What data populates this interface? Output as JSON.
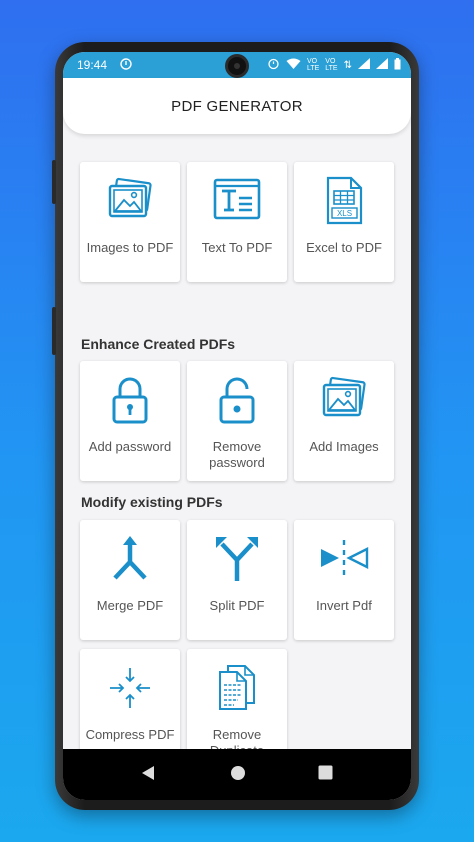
{
  "status": {
    "time": "19:44",
    "battery_icon": "battery-icon",
    "wifi_icon": "wifi-icon",
    "signal_icon": "signal-icon"
  },
  "app": {
    "title": "PDF GENERATOR"
  },
  "colors": {
    "accent": "#1a8fc9",
    "statusbar": "#2aa0d6",
    "background_gradient_top": "#2f6ff0",
    "background_gradient_bottom": "#1ba8ee"
  },
  "sections": {
    "convert": {
      "items": [
        {
          "label": "Images to PDF",
          "icon": "images-icon"
        },
        {
          "label": "Text To PDF",
          "icon": "text-document-icon"
        },
        {
          "label": "Excel to PDF",
          "icon": "xls-file-icon"
        }
      ]
    },
    "enhance": {
      "title": "Enhance Created PDFs",
      "items": [
        {
          "label": "Add password",
          "icon": "lock-icon"
        },
        {
          "label": "Remove password",
          "icon": "unlock-icon"
        },
        {
          "label": "Add Images",
          "icon": "images-icon"
        }
      ]
    },
    "modify": {
      "title": "Modify existing PDFs",
      "items": [
        {
          "label": "Merge PDF",
          "icon": "merge-icon"
        },
        {
          "label": "Split PDF",
          "icon": "split-icon"
        },
        {
          "label": "Invert Pdf",
          "icon": "invert-icon"
        },
        {
          "label": "Compress PDF",
          "icon": "compress-icon"
        },
        {
          "label": "Remove Duplicate",
          "icon": "duplicate-pages-icon"
        }
      ]
    }
  }
}
